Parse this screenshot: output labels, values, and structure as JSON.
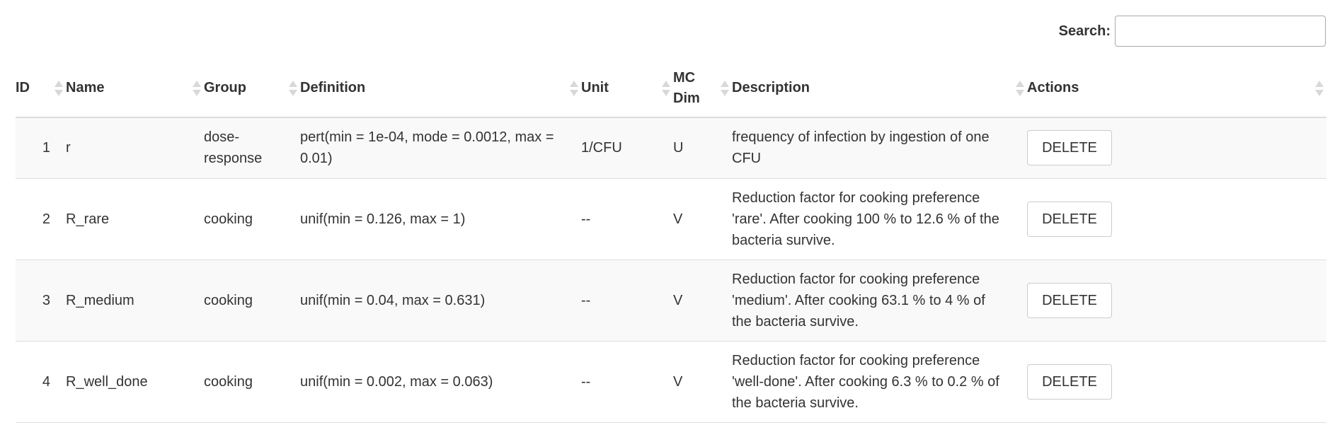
{
  "search": {
    "label": "Search:",
    "value": "",
    "placeholder": ""
  },
  "table": {
    "headers": {
      "id": "ID",
      "name": "Name",
      "group": "Group",
      "definition": "Definition",
      "unit": "Unit",
      "mcdim": "MC Dim",
      "description": "Description",
      "actions": "Actions"
    },
    "rows": [
      {
        "id": "1",
        "name": "r",
        "group": "dose-response",
        "definition": "pert(min = 1e-04, mode = 0.0012, max = 0.01)",
        "unit": "1/CFU",
        "mcdim": "U",
        "description": "frequency of infection by ingestion of one CFU",
        "action": "DELETE"
      },
      {
        "id": "2",
        "name": "R_rare",
        "group": "cooking",
        "definition": "unif(min = 0.126, max = 1)",
        "unit": "--",
        "mcdim": "V",
        "description": "Reduction factor for cooking preference 'rare'. After cooking 100 % to 12.6 % of the bacteria survive.",
        "action": "DELETE"
      },
      {
        "id": "3",
        "name": "R_medium",
        "group": "cooking",
        "definition": "unif(min = 0.04, max = 0.631)",
        "unit": "--",
        "mcdim": "V",
        "description": "Reduction factor for cooking preference 'medium'. After cooking 63.1 % to 4 % of the bacteria survive.",
        "action": "DELETE"
      },
      {
        "id": "4",
        "name": "R_well_done",
        "group": "cooking",
        "definition": "unif(min = 0.002, max = 0.063)",
        "unit": "--",
        "mcdim": "V",
        "description": "Reduction factor for cooking preference 'well-done'. After cooking 6.3 % to 0.2 % of the bacteria survive.",
        "action": "DELETE"
      }
    ]
  }
}
